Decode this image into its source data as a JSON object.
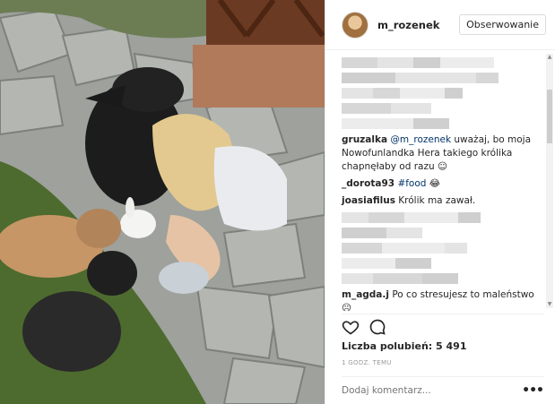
{
  "post": {
    "username": "m_rozenek",
    "follow_label": "Obserwowanie"
  },
  "comments": [
    {
      "user": "gruzalka",
      "mention": "@m_rozenek",
      "text": " uważaj, bo moja Nowofunlandka Hera takiego królika chapnęłaby od razu ☺"
    },
    {
      "user": "_dorota93",
      "tag": "#food",
      "text": " 😂"
    },
    {
      "user": "joasiafilus",
      "text": " Królik ma zawał."
    },
    {
      "user": "m_agda.j",
      "text": " Po co stresujesz to maleństwo ☹"
    }
  ],
  "likes_label": "Liczba polubień: 5 491",
  "time_label": "1 GODZ. TEMU",
  "comment_placeholder": "Dodaj komentarz...",
  "icons": {
    "like": "heart-icon",
    "comment": "comment-bubble-icon",
    "more": "more-options-icon",
    "scroll_up": "▲",
    "scroll_down": "▼"
  },
  "colors": {
    "link": "#003569",
    "border": "#dbdbdb",
    "muted": "#999999"
  }
}
